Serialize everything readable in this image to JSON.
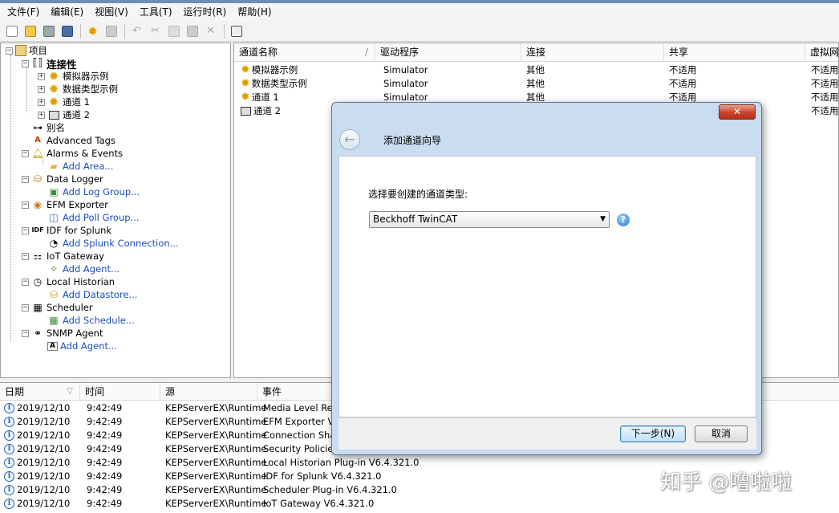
{
  "menu": [
    "文件(F)",
    "编辑(E)",
    "视图(V)",
    "工具(T)",
    "运行时(R)",
    "帮助(H)"
  ],
  "toolbar_icons": [
    "new-icon",
    "open-icon",
    "save-icon",
    "save-as-icon",
    "runtime-gear-icon",
    "properties-icon",
    "undo-icon",
    "cut-icon",
    "copy-icon",
    "paste-icon",
    "delete-icon",
    "quick-client-icon"
  ],
  "tree": {
    "root": "项目",
    "connectivity": "连接性",
    "channels": [
      "模拟器示例",
      "数据类型示例",
      "通道 1",
      "通道 2"
    ],
    "alias": "别名",
    "advanced_tags": "Advanced Tags",
    "alarms": "Alarms & Events",
    "add_area": "Add Area...",
    "data_logger": "Data Logger",
    "add_log_group": "Add Log Group...",
    "efm": "EFM Exporter",
    "add_poll_group": "Add Poll Group...",
    "idf": "IDF for Splunk",
    "add_splunk": "Add Splunk Connection...",
    "iot": "IoT Gateway",
    "add_agent_iot": "Add Agent...",
    "historian": "Local Historian",
    "add_datastore": "Add Datastore...",
    "scheduler": "Scheduler",
    "add_schedule": "Add Schedule...",
    "snmp": "SNMP Agent",
    "add_agent_snmp": "Add Agent..."
  },
  "channels_table": {
    "headers": [
      "通道名称",
      "驱动程序",
      "连接",
      "共享",
      "虚拟网"
    ],
    "rows": [
      {
        "name": "模拟器示例",
        "driver": "Simulator",
        "conn": "其他",
        "share": "不适用",
        "vnet": "不适用"
      },
      {
        "name": "数据类型示例",
        "driver": "Simulator",
        "conn": "其他",
        "share": "不适用",
        "vnet": "不适用"
      },
      {
        "name": "通道 1",
        "driver": "Simulator",
        "conn": "其他",
        "share": "不适用",
        "vnet": "不适用"
      },
      {
        "name": "通道 2",
        "driver": "",
        "conn": "",
        "share": "",
        "vnet": "不适用"
      }
    ]
  },
  "log": {
    "headers": [
      "日期",
      "时间",
      "源",
      "事件"
    ],
    "rows": [
      {
        "date": "2019/12/10",
        "time": "9:42:49",
        "src": "KEPServerEX\\Runtime",
        "event": "Media Level Redu"
      },
      {
        "date": "2019/12/10",
        "time": "9:42:49",
        "src": "KEPServerEX\\Runtime",
        "event": "EFM Exporter V6.4"
      },
      {
        "date": "2019/12/10",
        "time": "9:42:49",
        "src": "KEPServerEX\\Runtime",
        "event": "Connection Sharin"
      },
      {
        "date": "2019/12/10",
        "time": "9:42:49",
        "src": "KEPServerEX\\Runtime",
        "event": "Security Policies F"
      },
      {
        "date": "2019/12/10",
        "time": "9:42:49",
        "src": "KEPServerEX\\Runtime",
        "event": "Local Historian Plug-in V6.4.321.0"
      },
      {
        "date": "2019/12/10",
        "time": "9:42:49",
        "src": "KEPServerEX\\Runtime",
        "event": "IDF for Splunk V6.4.321.0"
      },
      {
        "date": "2019/12/10",
        "time": "9:42:49",
        "src": "KEPServerEX\\Runtime",
        "event": "Scheduler Plug-in V6.4.321.0"
      },
      {
        "date": "2019/12/10",
        "time": "9:42:49",
        "src": "KEPServerEX\\Runtime",
        "event": "IoT Gateway V6.4.321.0"
      }
    ]
  },
  "dialog": {
    "close": "✕",
    "title": "添加通道向导",
    "prompt": "选择要创建的通道类型:",
    "selected": "Beckhoff TwinCAT",
    "next": "下一步(N)",
    "cancel": "取消"
  },
  "watermark": "知乎 @噜啦啦"
}
